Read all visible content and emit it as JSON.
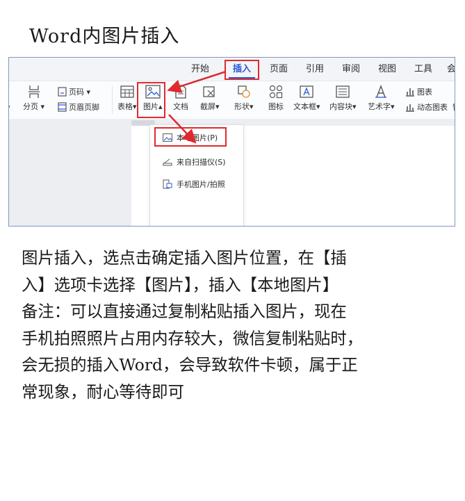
{
  "heading": "Word内图片插入",
  "screenshot": {
    "tabs": [
      {
        "label": "开始",
        "active": false
      },
      {
        "label": "插入",
        "active": true
      },
      {
        "label": "页面",
        "active": false
      },
      {
        "label": "引用",
        "active": false
      },
      {
        "label": "审阅",
        "active": false
      },
      {
        "label": "视图",
        "active": false
      },
      {
        "label": "工具",
        "active": false
      },
      {
        "label": "会员",
        "active": false
      }
    ],
    "ribbon": {
      "page_break": "分页",
      "page_number": "页码",
      "header_footer": "页眉页脚",
      "table": "表格",
      "picture": "图片",
      "document": "文档",
      "screenshot": "截屏",
      "shape": "形状",
      "icon": "图标",
      "textbox": "文本框",
      "content_block": "内容块",
      "art_text": "艺术字",
      "chart": "图表",
      "dynamic_chart": "动态图表",
      "more": "智"
    },
    "menu": [
      {
        "label": "本地图片(P)"
      },
      {
        "label": "来自扫描仪(S)"
      },
      {
        "label": "手机图片/拍照"
      }
    ],
    "highlight_color": "#e0292e",
    "accent_color": "#2a5bd7"
  },
  "body": {
    "lines": [
      "图片插入，选点击确定插入图片位置，在【插",
      "入】选项卡选择【图片】，插入【本地图片】",
      "备注：可以直接通过复制粘贴插入图片，现在",
      "手机拍照照片占用内存较大，微信复制粘贴时，",
      "会无损的插入Word，会导致软件卡顿，属于正",
      "常现象，耐心等待即可"
    ]
  }
}
